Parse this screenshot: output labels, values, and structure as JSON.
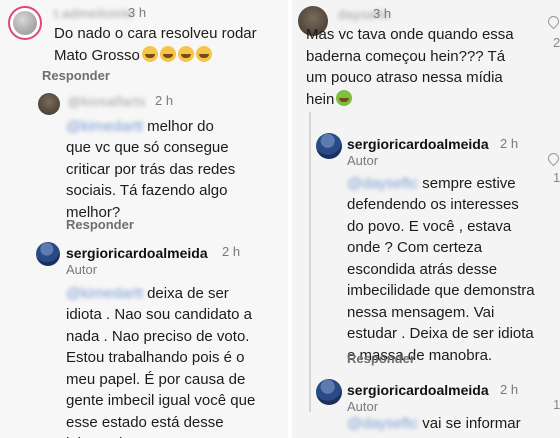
{
  "left": {
    "c1": {
      "user": "t.admeiloinle",
      "time": "3 h",
      "text_main": "Do nado o cara resolveu rodar\nMato Grosso",
      "reply": "Responder"
    },
    "c2": {
      "user": "@kiosalfarts",
      "time": "2 h",
      "mention": "@kimedartt",
      "text_first": " melhor do",
      "text_rest": "que vc que só consegue\ncriticar por trás das redes\nsociais. Tá fazendo algo\nmelhor?",
      "reply": "Responder"
    },
    "c3": {
      "user": "sergioricardoalmeida",
      "time": "2 h",
      "badge": "Autor",
      "mention": "@kimedartt",
      "text_first": " deixa de ser",
      "text_rest": "idiota . Nao sou candidato a\nnada . Nao preciso de voto.\nEstou trabalhando pois é o\nmeu papel. É por causa de\ngente imbecil igual você que\nesse estado está desse\njeito. Vai procurar o que"
    }
  },
  "right": {
    "c1": {
      "user": "dayseftc",
      "time": "3 h",
      "text_main": "Mas vc tava onde quando essa\nbaderna começou hein??? Tá\num pouco atraso nessa mídia\nhein"
    },
    "c2": {
      "user": "sergioricardoalmeida",
      "time": "2 h",
      "badge": "Autor",
      "mention": "@dayseftc",
      "text_first": " sempre estive",
      "text_rest": "defendendo os interesses\ndo povo. E você , estava\nonde ? Com certeza\nescondida atrás desse\nimbecilidade que demonstra\nnessa mensagem. Vai\nestudar . Deixa de ser idiota\ne massa de manobra.",
      "reply": "Responder"
    },
    "c3": {
      "user": "sergioricardoalmeida",
      "time": "2 h",
      "badge": "Autor",
      "mention": "@dayseftc",
      "text_first": " vai se informar"
    },
    "counts": [
      "2",
      "1",
      "1"
    ]
  },
  "icons": {
    "like": "heart-icon",
    "emoji_laugh": "laughing-emoji-icon",
    "emoji_sick": "nauseated-emoji-icon"
  },
  "colors": {
    "mention": "#7b9cd4",
    "story_ring": "#e0457b"
  }
}
